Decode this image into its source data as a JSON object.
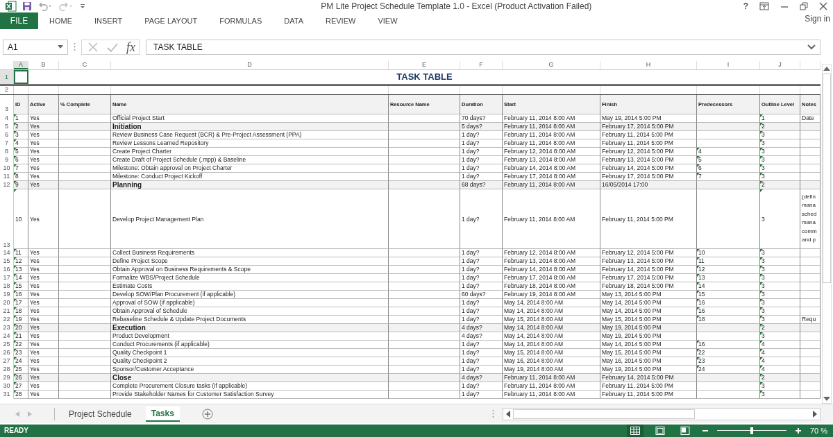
{
  "window": {
    "title": "PM Lite Project Schedule Template 1.0 - Excel (Product Activation Failed)",
    "help": "?",
    "sign_in": "Sign in"
  },
  "ribbon_tabs": [
    {
      "label": "FILE",
      "kind": "file"
    },
    {
      "label": "HOME",
      "kind": "tab"
    },
    {
      "label": "INSERT",
      "kind": "tab"
    },
    {
      "label": "PAGE LAYOUT",
      "kind": "tab"
    },
    {
      "label": "FORMULAS",
      "kind": "tab"
    },
    {
      "label": "DATA",
      "kind": "tab"
    },
    {
      "label": "REVIEW",
      "kind": "tab"
    },
    {
      "label": "VIEW",
      "kind": "tab"
    }
  ],
  "formula_bar": {
    "name_box": "A1",
    "insert_function": "fx",
    "formula": "TASK TABLE"
  },
  "column_headers": [
    {
      "label": "A",
      "selected": true
    },
    {
      "label": "B",
      "selected": false
    },
    {
      "label": "C",
      "selected": false
    },
    {
      "label": "D",
      "selected": false
    },
    {
      "label": "E",
      "selected": false
    },
    {
      "label": "F",
      "selected": false
    },
    {
      "label": "G",
      "selected": false
    },
    {
      "label": "H",
      "selected": false
    },
    {
      "label": "I",
      "selected": false
    },
    {
      "label": "J",
      "selected": false
    }
  ],
  "title_row": {
    "number": "1",
    "selected": true,
    "title": "TASK TABLE"
  },
  "blank_row": {
    "number": "2"
  },
  "header_row": {
    "number": "3",
    "labels": [
      "ID",
      "Active",
      "% Complete",
      "Name",
      "Resource Name",
      "Duration",
      "Start",
      "Finish",
      "Predecessors",
      "Outline Level",
      "Notes"
    ]
  },
  "rows": [
    {
      "number": "4",
      "kind": "task",
      "id": "1",
      "active": "Yes",
      "name": "Official Project Start",
      "duration": "70 days?",
      "start": "February 11, 2014 8:00 AM",
      "finish": "May 19, 2014 5:00 PM",
      "outline_level": "1",
      "notes": "Date"
    },
    {
      "number": "5",
      "kind": "summary",
      "id": "2",
      "active": "Yes",
      "name": "Initiation",
      "duration": "5 days?",
      "start": "February 11, 2014 8:00 AM",
      "finish": "February 17, 2014 5:00 PM",
      "outline_level": "2"
    },
    {
      "number": "6",
      "kind": "task",
      "id": "3",
      "active": "Yes",
      "name": "Review Business Case Request (BCR) & Pre-Project Assessment (PPA)",
      "duration": "1 day?",
      "start": "February 11, 2014 8:00 AM",
      "finish": "February 11, 2014 5:00 PM",
      "outline_level": "3"
    },
    {
      "number": "7",
      "kind": "task",
      "id": "4",
      "active": "Yes",
      "name": "Review Lessons Learned Repository",
      "duration": "1 day?",
      "start": "February 11, 2014 8:00 AM",
      "finish": "February 11, 2014 5:00 PM",
      "outline_level": "3"
    },
    {
      "number": "8",
      "kind": "task",
      "id": "5",
      "active": "Yes",
      "name": "Create Project Charter",
      "duration": "1 day?",
      "start": "February 12, 2014 8:00 AM",
      "finish": "February 12, 2014 5:00 PM",
      "predecessors": "4",
      "outline_level": "3"
    },
    {
      "number": "9",
      "kind": "task",
      "id": "6",
      "active": "Yes",
      "name": "Create Draft of Project Schedule (.mpp) & Baseline",
      "duration": "1 day?",
      "start": "February 13, 2014 8:00 AM",
      "finish": "February 13, 2014 5:00 PM",
      "predecessors": "5",
      "outline_level": "3"
    },
    {
      "number": "10",
      "kind": "task",
      "id": "7",
      "active": "Yes",
      "name": "Milestone: Obtain approval on Project Charter",
      "duration": "1 day?",
      "start": "February 14, 2014 8:00 AM",
      "finish": "February 14, 2014 5:00 PM",
      "predecessors": "6",
      "outline_level": "3"
    },
    {
      "number": "11",
      "kind": "task",
      "id": "8",
      "active": "Yes",
      "name": "Milestone: Conduct Project Kickoff",
      "duration": "1 day?",
      "start": "February 17, 2014 8:00 AM",
      "finish": "February 17, 2014 5:00 PM",
      "predecessors": "7",
      "outline_level": "3"
    },
    {
      "number": "12",
      "kind": "summary",
      "id": "9",
      "active": "Yes",
      "name": "Planning",
      "duration": "68 days?",
      "start": "February 11, 2014 8:00 AM",
      "finish": "16/05/2014 17:00",
      "outline_level": "2"
    },
    {
      "number": "13",
      "kind": "wrapped",
      "id": "10",
      "active": "Yes",
      "name": "Develop Project Management Plan",
      "duration": "1 day?",
      "start": "February 11, 2014 8:00 AM",
      "finish": "February 11, 2014 5:00 PM",
      "outline_level": "3",
      "notes": "(defin\nmana\nsched\nmana\ncomm\nand p"
    },
    {
      "number": "14",
      "kind": "task",
      "id": "11",
      "active": "Yes",
      "name": "Collect Business Requirements",
      "duration": "1 day?",
      "start": "February 12, 2014 8:00 AM",
      "finish": "February 12, 2014 5:00 PM",
      "predecessors": "10",
      "outline_level": "3"
    },
    {
      "number": "15",
      "kind": "task",
      "id": "12",
      "active": "Yes",
      "name": "Define Project Scope",
      "duration": "1 day?",
      "start": "February 13, 2014 8:00 AM",
      "finish": "February 13, 2014 5:00 PM",
      "predecessors": "11",
      "outline_level": "3"
    },
    {
      "number": "16",
      "kind": "task",
      "id": "13",
      "active": "Yes",
      "name": "Obtain Approval on Business Requirements & Scope",
      "duration": "1 day?",
      "start": "February 14, 2014 8:00 AM",
      "finish": "February 14, 2014 5:00 PM",
      "predecessors": "12",
      "outline_level": "3"
    },
    {
      "number": "17",
      "kind": "task",
      "id": "14",
      "active": "Yes",
      "name": "Formalize WBS/Project Schedule",
      "duration": "1 day?",
      "start": "February 17, 2014 8:00 AM",
      "finish": "February 17, 2014 5:00 PM",
      "predecessors": "13",
      "outline_level": "3"
    },
    {
      "number": "18",
      "kind": "task",
      "id": "15",
      "active": "Yes",
      "name": "Estimate Costs",
      "duration": "1 day?",
      "start": "February 18, 2014 8:00 AM",
      "finish": "February 18, 2014 5:00 PM",
      "predecessors": "14",
      "outline_level": "3"
    },
    {
      "number": "19",
      "kind": "task",
      "id": "16",
      "active": "Yes",
      "name": "Develop SOW/Plan Procurement  (if applicable)",
      "duration": "60 days?",
      "start": "February 19, 2014 8:00 AM",
      "finish": "May 13, 2014 5:00 PM",
      "predecessors": "15",
      "outline_level": "3"
    },
    {
      "number": "20",
      "kind": "task",
      "id": "17",
      "active": "Yes",
      "name": "Approval of SOW (if applicable)",
      "duration": "1 day?",
      "start": "May 14, 2014 8:00 AM",
      "finish": "May 14, 2014 5:00 PM",
      "predecessors": "16",
      "outline_level": "3"
    },
    {
      "number": "21",
      "kind": "task",
      "id": "18",
      "active": "Yes",
      "name": "Obtain Approval of Schedule",
      "duration": "1 day?",
      "start": "May 14, 2014 8:00 AM",
      "finish": "May 14, 2014 5:00 PM",
      "predecessors": "16",
      "outline_level": "3"
    },
    {
      "number": "22",
      "kind": "task",
      "id": "19",
      "active": "Yes",
      "name": "Rebaseline Schedule & Update Project Documents",
      "duration": "1 day?",
      "start": "May 15, 2014 8:00 AM",
      "finish": "May 15, 2014 5:00 PM",
      "predecessors": "18",
      "outline_level": "3",
      "notes": "Requ"
    },
    {
      "number": "23",
      "kind": "summary",
      "id": "20",
      "active": "Yes",
      "name": "Execution",
      "duration": "4 days?",
      "start": "May 14, 2014 8:00 AM",
      "finish": "May 19, 2014 5:00 PM",
      "outline_level": "2"
    },
    {
      "number": "24",
      "kind": "task",
      "id": "21",
      "active": "Yes",
      "name": "Product Development",
      "duration": "4 days?",
      "start": "May 14, 2014 8:00 AM",
      "finish": "May 19, 2014 5:00 PM",
      "outline_level": "3"
    },
    {
      "number": "25",
      "kind": "task",
      "id": "22",
      "active": "Yes",
      "name": "Conduct Procurements (if applicable)",
      "duration": "1 day?",
      "start": "May 14, 2014 8:00 AM",
      "finish": "May 14, 2014 5:00 PM",
      "predecessors": "16",
      "outline_level": "4"
    },
    {
      "number": "26",
      "kind": "task",
      "id": "23",
      "active": "Yes",
      "name": "Quality Checkpoint 1",
      "duration": "1 day?",
      "start": "May 15, 2014 8:00 AM",
      "finish": "May 15, 2014 5:00 PM",
      "predecessors": "22",
      "outline_level": "4"
    },
    {
      "number": "27",
      "kind": "task",
      "id": "24",
      "active": "Yes",
      "name": "Quality Checkpoint 2",
      "duration": "1 day?",
      "start": "May 16, 2014 8:00 AM",
      "finish": "May 16, 2014 5:00 PM",
      "predecessors": "23",
      "outline_level": "4"
    },
    {
      "number": "28",
      "kind": "task",
      "id": "25",
      "active": "Yes",
      "name": "Sponsor/Customer Acceptance",
      "duration": "1 day?",
      "start": "May 19, 2014 8:00 AM",
      "finish": "May 19, 2014 5:00 PM",
      "predecessors": "24",
      "outline_level": "4"
    },
    {
      "number": "29",
      "kind": "summary",
      "id": "26",
      "active": "Yes",
      "name": "Close",
      "duration": "4 days?",
      "start": "February 11, 2014 8:00 AM",
      "finish": "February 14, 2014 5:00 PM",
      "outline_level": "2"
    },
    {
      "number": "30",
      "kind": "task",
      "id": "27",
      "active": "Yes",
      "name": "Complete Procurement Closure tasks (if applicable)",
      "duration": "1 day?",
      "start": "February 11, 2014 8:00 AM",
      "finish": "February 11, 2014 5:00 PM",
      "outline_level": "3"
    },
    {
      "number": "31",
      "kind": "task",
      "id": "28",
      "active": "Yes",
      "name": "Provide Stakeholder Names for Customer Satisfaction Survey",
      "duration": "1 day?",
      "start": "February 11, 2014 8:00 AM",
      "finish": "February 11, 2014 5:00 PM",
      "outline_level": "3"
    }
  ],
  "sheet_tabs": [
    {
      "label": "Project Schedule",
      "selected": false
    },
    {
      "label": "Tasks",
      "selected": true
    }
  ],
  "status_bar": {
    "status": "READY",
    "views": [
      {
        "kind": "normal",
        "selected": true
      },
      {
        "kind": "page_layout",
        "selected": false
      },
      {
        "kind": "page_break",
        "selected": false
      }
    ],
    "zoom": {
      "level": 0.5,
      "reading": "70 %"
    }
  }
}
